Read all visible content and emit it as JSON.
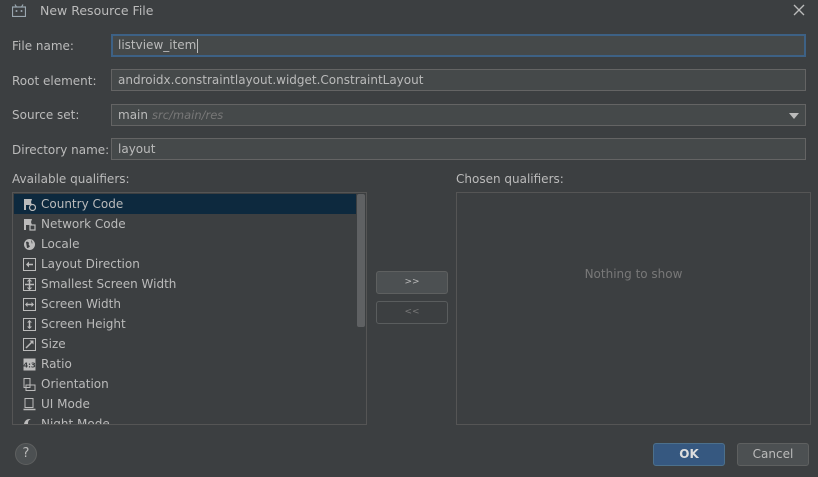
{
  "window": {
    "title": "New Resource File"
  },
  "form": {
    "file_name_label": "File name:",
    "file_name_value": "listview_item",
    "root_element_label": "Root element:",
    "root_element_value": "androidx.constraintlayout.widget.ConstraintLayout",
    "source_set_label": "Source set:",
    "source_set_value": "main",
    "source_set_path": "src/main/res",
    "directory_label": "Directory name:",
    "directory_value": "layout"
  },
  "qualifiers": {
    "available_label": "Available qualifiers:",
    "chosen_label": "Chosen qualifiers:",
    "empty_text": "Nothing to show",
    "add_button": ">>",
    "remove_button": "<<",
    "items": [
      {
        "label": "Country Code",
        "icon": "country-code-icon"
      },
      {
        "label": "Network Code",
        "icon": "network-code-icon"
      },
      {
        "label": "Locale",
        "icon": "globe-icon"
      },
      {
        "label": "Layout Direction",
        "icon": "layout-direction-icon"
      },
      {
        "label": "Smallest Screen Width",
        "icon": "smallest-width-icon"
      },
      {
        "label": "Screen Width",
        "icon": "screen-width-icon"
      },
      {
        "label": "Screen Height",
        "icon": "screen-height-icon"
      },
      {
        "label": "Size",
        "icon": "size-icon"
      },
      {
        "label": "Ratio",
        "icon": "ratio-icon"
      },
      {
        "label": "Orientation",
        "icon": "orientation-icon"
      },
      {
        "label": "UI Mode",
        "icon": "ui-mode-icon"
      },
      {
        "label": "Night Mode",
        "icon": "night-mode-icon"
      }
    ]
  },
  "buttons": {
    "help": "?",
    "ok": "OK",
    "cancel": "Cancel"
  },
  "colors": {
    "background": "#3c3f41",
    "selection": "#0d293e",
    "ok_button": "#365880",
    "focus_border": "#3d6185"
  }
}
